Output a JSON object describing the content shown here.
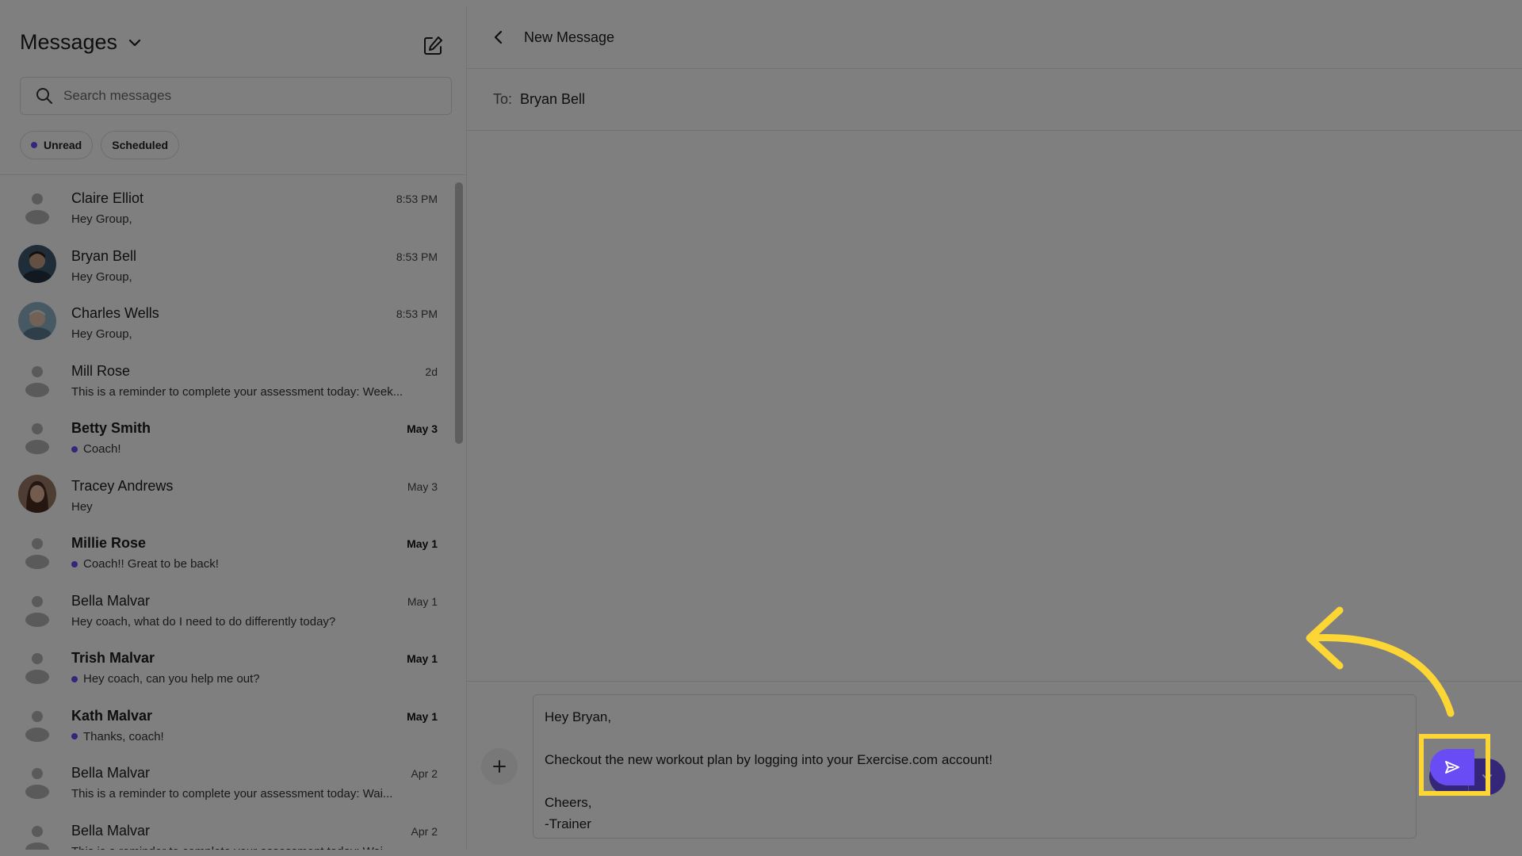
{
  "sidebar": {
    "title": "Messages",
    "search_placeholder": "Search messages",
    "filters": [
      {
        "label": "Unread",
        "has_dot": true
      },
      {
        "label": "Scheduled",
        "has_dot": false
      }
    ],
    "conversations": [
      {
        "name": "Claire Elliot",
        "preview": "Hey Group,",
        "time": "8:53 PM",
        "unread": false,
        "avatar": "placeholder"
      },
      {
        "name": "Bryan Bell",
        "preview": "Hey Group,",
        "time": "8:53 PM",
        "unread": false,
        "avatar": "photo-bryan"
      },
      {
        "name": "Charles Wells",
        "preview": "Hey Group,",
        "time": "8:53 PM",
        "unread": false,
        "avatar": "photo-charles"
      },
      {
        "name": "Mill Rose",
        "preview": "This is a reminder to complete your assessment today: Week...",
        "time": "2d",
        "unread": false,
        "avatar": "placeholder"
      },
      {
        "name": "Betty Smith",
        "preview": "Coach!",
        "time": "May 3",
        "unread": true,
        "avatar": "placeholder"
      },
      {
        "name": "Tracey Andrews",
        "preview": "Hey",
        "time": "May 3",
        "unread": false,
        "avatar": "photo-tracey"
      },
      {
        "name": "Millie Rose",
        "preview": "Coach!! Great to be back!",
        "time": "May 1",
        "unread": true,
        "avatar": "placeholder"
      },
      {
        "name": "Bella Malvar",
        "preview": "Hey coach, what do I need to do differently today?",
        "time": "May 1",
        "unread": false,
        "avatar": "placeholder"
      },
      {
        "name": "Trish Malvar",
        "preview": "Hey coach, can you help me out?",
        "time": "May 1",
        "unread": true,
        "avatar": "placeholder"
      },
      {
        "name": "Kath Malvar",
        "preview": "Thanks, coach!",
        "time": "May 1",
        "unread": true,
        "avatar": "placeholder"
      },
      {
        "name": "Bella Malvar",
        "preview": "This is a reminder to complete your assessment today: Wai...",
        "time": "Apr 2",
        "unread": false,
        "avatar": "placeholder"
      },
      {
        "name": "Bella Malvar",
        "preview": "This is a reminder to complete your assessment today: Wai...",
        "time": "Apr 2",
        "unread": false,
        "avatar": "placeholder"
      }
    ]
  },
  "main": {
    "header_title": "New Message",
    "to_label": "To:",
    "to_value": "Bryan Bell",
    "message_lines": [
      "Hey Bryan,",
      "",
      "Checkout the new workout plan by logging into your Exercise.com account!",
      "",
      "Cheers,",
      "-Trainer"
    ]
  },
  "colors": {
    "accent": "#6a4cf5",
    "highlight": "#fbd635",
    "overlay": "rgba(0,0,0,0.5)"
  },
  "icons": {
    "sidebar": [
      "chevron-down-icon",
      "compose-icon",
      "search-icon"
    ],
    "main": [
      "back-arrow-icon",
      "plus-icon",
      "send-icon",
      "chevron-down-icon"
    ],
    "annotation": "curved-arrow-icon"
  }
}
